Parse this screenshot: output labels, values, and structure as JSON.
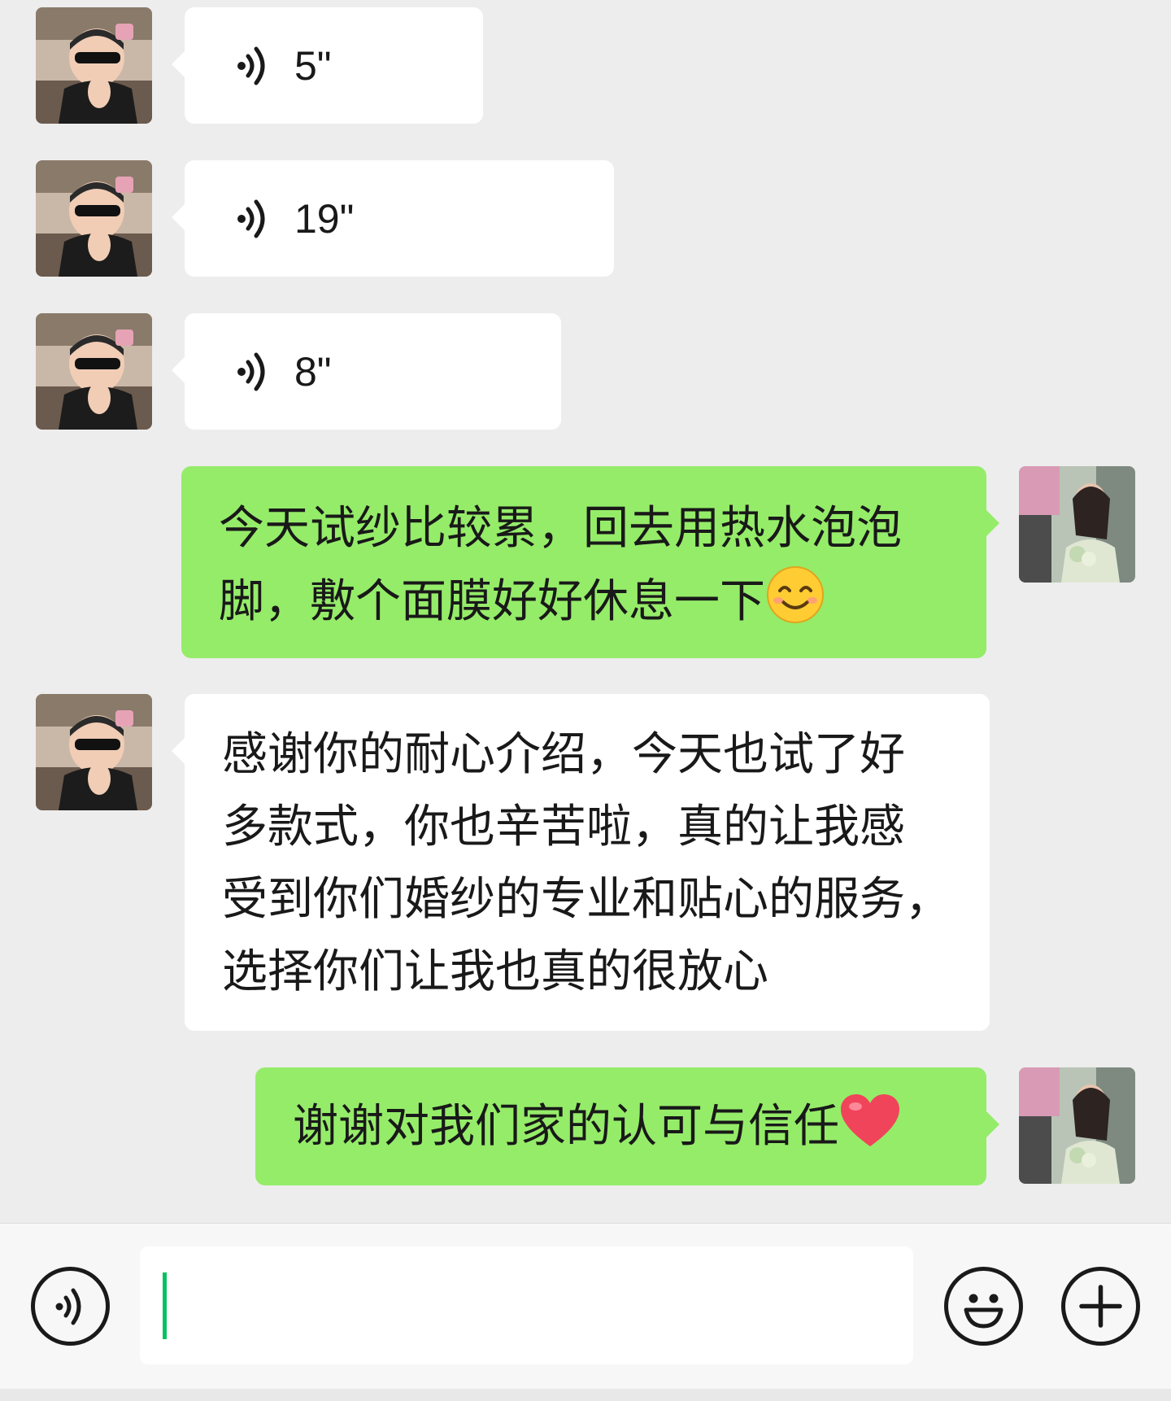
{
  "conversation": {
    "messages": [
      {
        "id": "m1",
        "direction": "incoming",
        "kind": "voice",
        "duration": "5\""
      },
      {
        "id": "m2",
        "direction": "incoming",
        "kind": "voice",
        "duration": "19\""
      },
      {
        "id": "m3",
        "direction": "incoming",
        "kind": "voice",
        "duration": "8\""
      },
      {
        "id": "m4",
        "direction": "outgoing",
        "kind": "text",
        "lines": [
          "今天试纱比较累，回去用热水泡泡",
          "脚，敷个面膜好好休息一下"
        ],
        "trailing_emoji": "smiling-face-emoji"
      },
      {
        "id": "m5",
        "direction": "incoming",
        "kind": "text",
        "lines": [
          "感谢你的耐心介绍，今天也试了好",
          "多款式，你也辛苦啦，真的让我感",
          "受到你们婚纱的专业和贴心的服务，",
          "选择你们让我也真的很放心"
        ]
      },
      {
        "id": "m6",
        "direction": "outgoing",
        "kind": "text",
        "lines": [
          "谢谢对我们家的认可与信任"
        ],
        "trailing_emoji": "red-heart-emoji"
      }
    ]
  },
  "input_bar": {
    "message_input_value": "",
    "voice_toggle_icon": "voice-icon",
    "emoji_button_icon": "smiley-icon",
    "more_button_icon": "plus-icon"
  },
  "colors": {
    "background": "#ededed",
    "incoming_bubble": "#ffffff",
    "outgoing_bubble": "#95ec69",
    "caret": "#07c160"
  }
}
